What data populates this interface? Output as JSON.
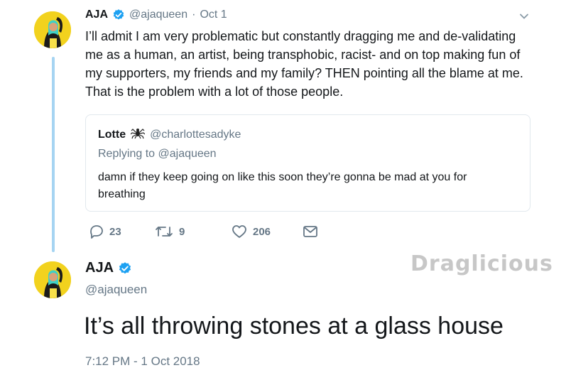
{
  "reply_tweet": {
    "display_name": "AJA",
    "handle": "@ajaqueen",
    "separator": "·",
    "date": "Oct 1",
    "text_lines": [
      "I’ll admit I am very problematic but constantly dragging me and de-validating",
      "me as a human, an artist, being transphobic, racist- and on top making fun of",
      "my supporters, my friends and my family? THEN pointing all the blame at me.",
      "That is the problem with a lot of those people."
    ],
    "quoted": {
      "display_name": "Lotte",
      "emoji": "spider-icon",
      "handle": "@charlottesadyke",
      "replying_to": "Replying to @ajaqueen",
      "text_lines": [
        "damn if they keep going on like this soon they’re gonna be mad at you for",
        "breathing"
      ]
    },
    "actions": {
      "replies": "23",
      "retweets": "9",
      "likes": "206"
    }
  },
  "main_tweet": {
    "display_name": "AJA",
    "handle": "@ajaqueen",
    "text": "It’s all throwing stones at a glass house",
    "timestamp": "7:12 PM - 1 Oct 2018"
  },
  "watermark": "Draglicious",
  "colors": {
    "verified_blue": "#1da1f2",
    "thread_line": "#a6d4f2",
    "muted_text": "#657786",
    "avatar_bg": "#f2d21e"
  }
}
